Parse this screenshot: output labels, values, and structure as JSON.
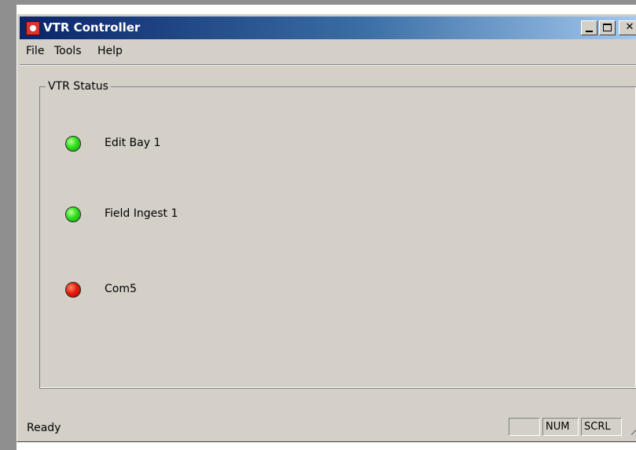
{
  "window": {
    "title": "VTR Controller"
  },
  "menu": {
    "items": [
      "File",
      "Tools",
      "Help"
    ]
  },
  "group": {
    "label": "VTR Status",
    "vtrs": [
      {
        "name": "Edit Bay 1",
        "status": "green"
      },
      {
        "name": "Field Ingest 1",
        "status": "green"
      },
      {
        "name": "Com5",
        "status": "red"
      }
    ]
  },
  "status": {
    "text": "Ready",
    "panels": [
      "",
      "NUM",
      "SCRL"
    ]
  },
  "colors": {
    "status_green": "#2ee01a",
    "status_red": "#e41c0c",
    "titlebar": "#0a246a"
  },
  "icons": {
    "app": "vtr-app-icon"
  }
}
